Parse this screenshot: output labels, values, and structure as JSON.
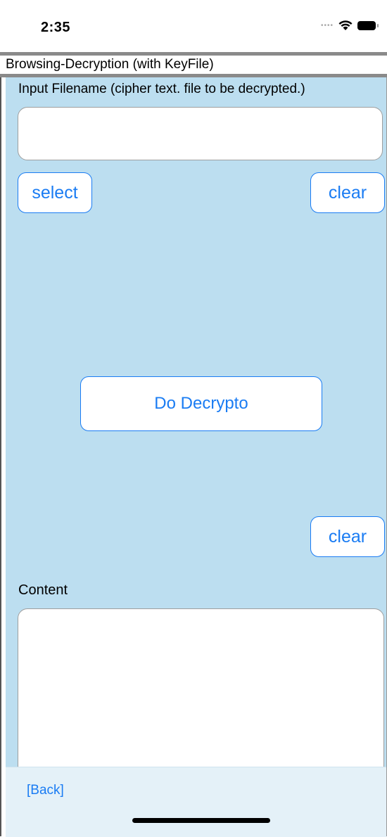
{
  "status_bar": {
    "time": "2:35",
    "icons": [
      "signal-icon",
      "wifi-icon",
      "battery-icon"
    ]
  },
  "title_bar": {
    "title": "Browsing-Decryption (with KeyFile)"
  },
  "main": {
    "input_label": "Input Filename (cipher text. file to be decrypted.)",
    "input_value": "",
    "select_label": "select",
    "clear_label_1": "clear",
    "do_label": "Do Decrypto",
    "clear_label_2": "clear",
    "content_label": "Content",
    "content_value": ""
  },
  "bottom_bar": {
    "back_label": "[Back]"
  },
  "colors": {
    "accent": "#1a7cf3",
    "main_background": "#bcdef0",
    "title_border": "#8a8a8a",
    "bottom_bar": "#e4f1f8"
  }
}
